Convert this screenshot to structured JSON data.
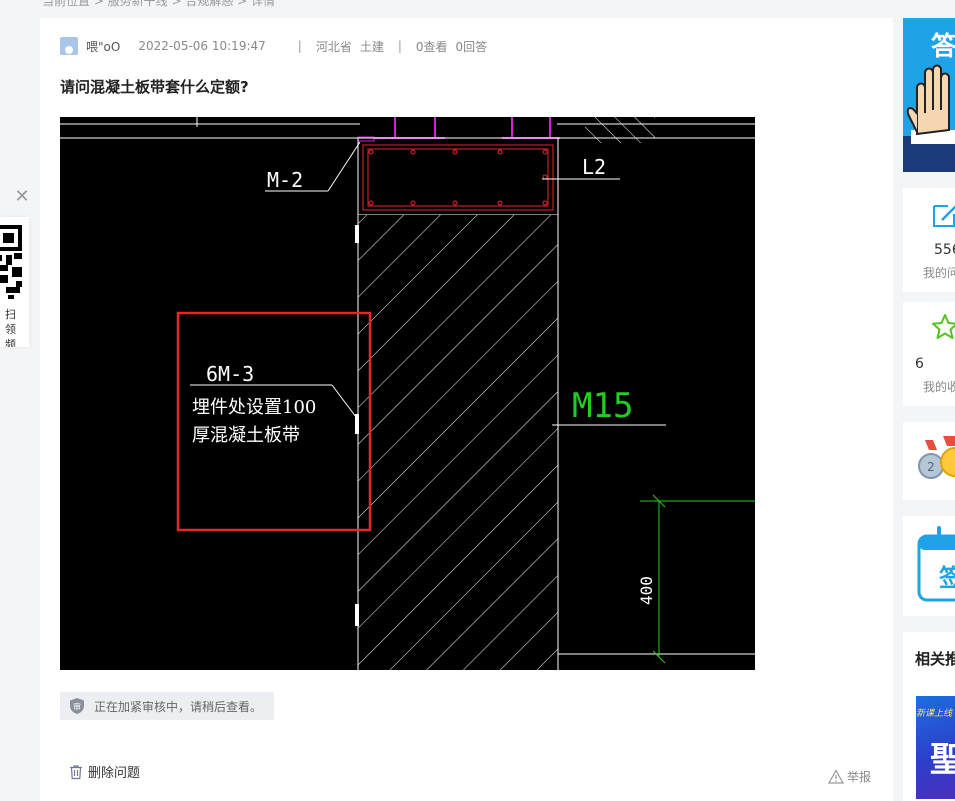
{
  "breadcrumb": "当前位置 > 服务新干线 > 合规解惑 > 详情",
  "question": {
    "username": "喂\"oO",
    "time": "2022-05-06 10:19:47",
    "separator": "|",
    "province": "河北省",
    "category": "土建",
    "views": "0查看",
    "answers": "0回答",
    "title": "请问混凝土板带套什么定额?"
  },
  "drawing": {
    "labels": {
      "m2": "M-2",
      "l2": "L2",
      "m6": "6M-3",
      "note_line1": "埋件处设置100",
      "note_line2": "厚混凝土板带",
      "m15": "M15",
      "dim": "400"
    },
    "colors": {
      "red": "#e8262c",
      "green": "#22cc22",
      "magenta": "#d020d0",
      "white": "#ffffff"
    }
  },
  "review_notice": "正在加紧审核中，请稍后查看。",
  "actions": {
    "delete": "删除问题",
    "report": "举报"
  },
  "left_float": {
    "close": "✕",
    "text_line1": "扫领",
    "text_line2": "频"
  },
  "sidebar": {
    "banner_text": "答",
    "questions_count": "556",
    "questions_label": "我的问",
    "favorites_count": "6",
    "favorites_label": "我的收",
    "sign_text": "签",
    "related_title": "相关推",
    "course_badge": "新课上线"
  },
  "accent_color": "#1fa3e8"
}
